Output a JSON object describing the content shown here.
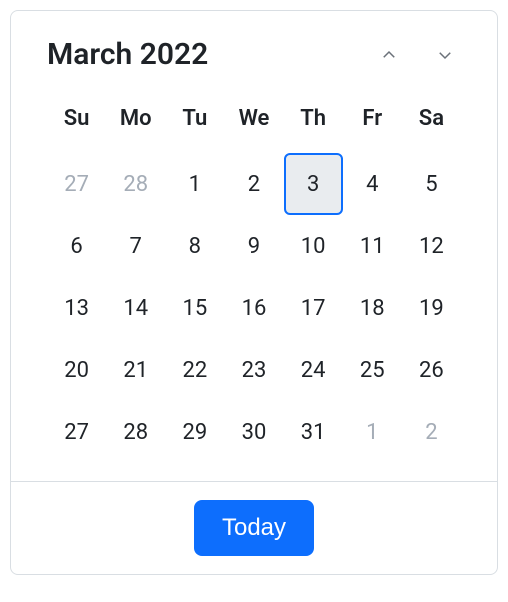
{
  "header": {
    "title": "March 2022"
  },
  "weekdays": [
    "Su",
    "Mo",
    "Tu",
    "We",
    "Th",
    "Fr",
    "Sa"
  ],
  "days": [
    {
      "label": "27",
      "out": true,
      "selected": false
    },
    {
      "label": "28",
      "out": true,
      "selected": false
    },
    {
      "label": "1",
      "out": false,
      "selected": false
    },
    {
      "label": "2",
      "out": false,
      "selected": false
    },
    {
      "label": "3",
      "out": false,
      "selected": true
    },
    {
      "label": "4",
      "out": false,
      "selected": false
    },
    {
      "label": "5",
      "out": false,
      "selected": false
    },
    {
      "label": "6",
      "out": false,
      "selected": false
    },
    {
      "label": "7",
      "out": false,
      "selected": false
    },
    {
      "label": "8",
      "out": false,
      "selected": false
    },
    {
      "label": "9",
      "out": false,
      "selected": false
    },
    {
      "label": "10",
      "out": false,
      "selected": false
    },
    {
      "label": "11",
      "out": false,
      "selected": false
    },
    {
      "label": "12",
      "out": false,
      "selected": false
    },
    {
      "label": "13",
      "out": false,
      "selected": false
    },
    {
      "label": "14",
      "out": false,
      "selected": false
    },
    {
      "label": "15",
      "out": false,
      "selected": false
    },
    {
      "label": "16",
      "out": false,
      "selected": false
    },
    {
      "label": "17",
      "out": false,
      "selected": false
    },
    {
      "label": "18",
      "out": false,
      "selected": false
    },
    {
      "label": "19",
      "out": false,
      "selected": false
    },
    {
      "label": "20",
      "out": false,
      "selected": false
    },
    {
      "label": "21",
      "out": false,
      "selected": false
    },
    {
      "label": "22",
      "out": false,
      "selected": false
    },
    {
      "label": "23",
      "out": false,
      "selected": false
    },
    {
      "label": "24",
      "out": false,
      "selected": false
    },
    {
      "label": "25",
      "out": false,
      "selected": false
    },
    {
      "label": "26",
      "out": false,
      "selected": false
    },
    {
      "label": "27",
      "out": false,
      "selected": false
    },
    {
      "label": "28",
      "out": false,
      "selected": false
    },
    {
      "label": "29",
      "out": false,
      "selected": false
    },
    {
      "label": "30",
      "out": false,
      "selected": false
    },
    {
      "label": "31",
      "out": false,
      "selected": false
    },
    {
      "label": "1",
      "out": true,
      "selected": false
    },
    {
      "label": "2",
      "out": true,
      "selected": false
    }
  ],
  "footer": {
    "today_label": "Today"
  },
  "colors": {
    "accent": "#0d6efd",
    "border": "#d9dee3",
    "muted": "#a5adb7",
    "selected_bg": "#e9ecef"
  }
}
